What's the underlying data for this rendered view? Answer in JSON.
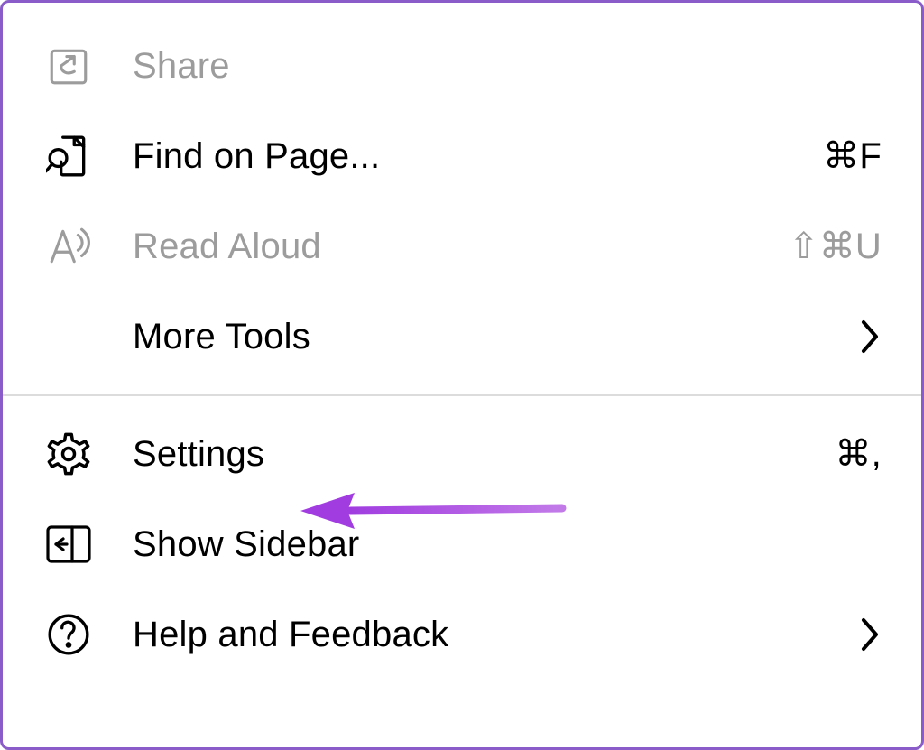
{
  "menu": {
    "share": {
      "label": "Share",
      "enabled": false
    },
    "find_on_page": {
      "label": "Find on Page...",
      "shortcut": "⌘F"
    },
    "read_aloud": {
      "label": "Read Aloud",
      "shortcut": "⇧⌘U",
      "enabled": false
    },
    "more_tools": {
      "label": "More Tools"
    },
    "settings": {
      "label": "Settings",
      "shortcut": "⌘,"
    },
    "show_sidebar": {
      "label": "Show Sidebar"
    },
    "help_feedback": {
      "label": "Help and Feedback"
    }
  },
  "annotation": {
    "color": "#a13de0",
    "targets": "settings"
  }
}
